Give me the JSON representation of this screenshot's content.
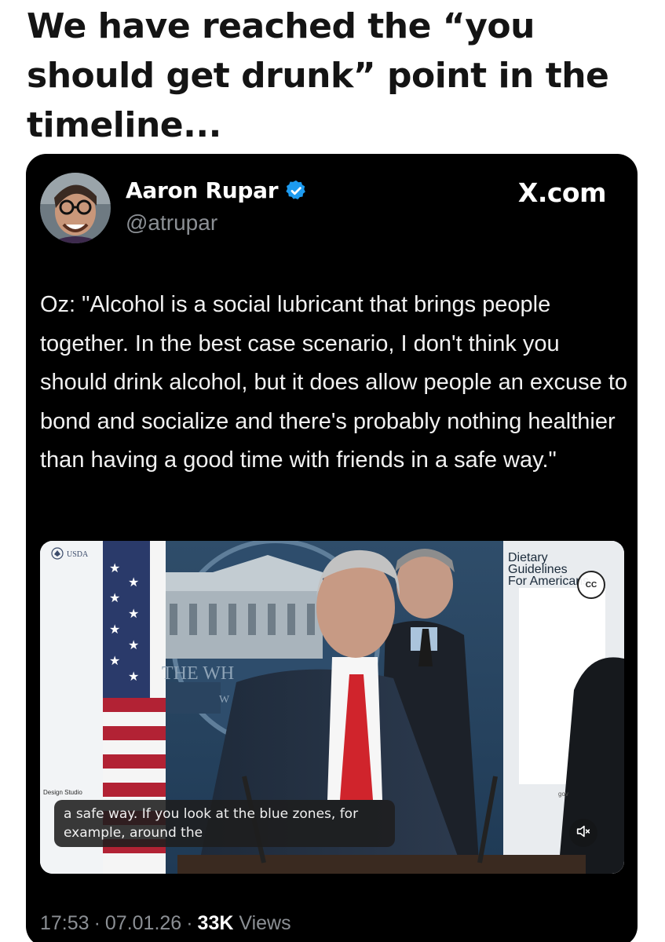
{
  "headline": {
    "text": "We have reached the “you should get drunk” point in the timeline..."
  },
  "tweet": {
    "author_name": "Aaron Rupar",
    "author_handle": "@atrupar",
    "brand": "X.com",
    "text": "Oz: \"Alcohol is a social lubricant that brings people together. In the best case scenario, I don't think you should drink alcohol, but it does allow people an excuse to bond and socialize and there's probably nothing healthier than having a good time with friends in a safe way.\"",
    "video": {
      "usda_label": "USDA",
      "dg_line1": "Dietary",
      "dg_line2": "Guidelines",
      "dg_line3": "For Americans",
      "cc_label": "CC",
      "podium_text": "THE WH",
      "podium_sub": "W",
      "design_studio": "Design Studio",
      "gov_label": "gov",
      "caption_line1": "a safe way. If you look at the blue zones, for",
      "caption_line2": "example, around the"
    },
    "time": "17:53",
    "date": "07.01.26",
    "views_count": "33K",
    "views_label": "Views",
    "dot": "·"
  },
  "colors": {
    "card_bg": "#000000",
    "verified_blue": "#1d9bf0",
    "muted_text": "#8b8f94"
  },
  "icons": {
    "verified": "verified-badge-icon",
    "mute": "speaker-muted-icon"
  }
}
